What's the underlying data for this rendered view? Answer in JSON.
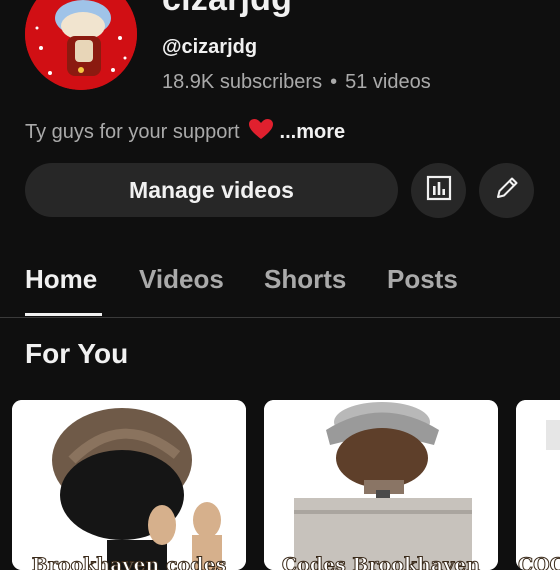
{
  "channel": {
    "name": "cizarjdg",
    "handle": "@cizarjdg",
    "subscribers": "18.9K subscribers",
    "separator": "•",
    "videos": "51 videos",
    "description": "Ty guys for your support",
    "more_label": "...more"
  },
  "actions": {
    "manage_label": "Manage videos",
    "analytics_icon": "analytics-icon",
    "edit_icon": "pencil-icon"
  },
  "tabs": [
    {
      "label": "Home",
      "active": true
    },
    {
      "label": "Videos",
      "active": false
    },
    {
      "label": "Shorts",
      "active": false
    },
    {
      "label": "Posts",
      "active": false
    }
  ],
  "section": {
    "title": "For You"
  },
  "cards": [
    {
      "caption": "Brookhaven codes"
    },
    {
      "caption": "Codes Brookhaven"
    },
    {
      "caption": "COC"
    }
  ],
  "colors": {
    "background": "#0f0f0f",
    "button": "#272727",
    "text_primary": "#f1f1f1",
    "text_secondary": "#aaaaaa",
    "avatar_red": "#d10f14",
    "heart": "#e0202e"
  }
}
